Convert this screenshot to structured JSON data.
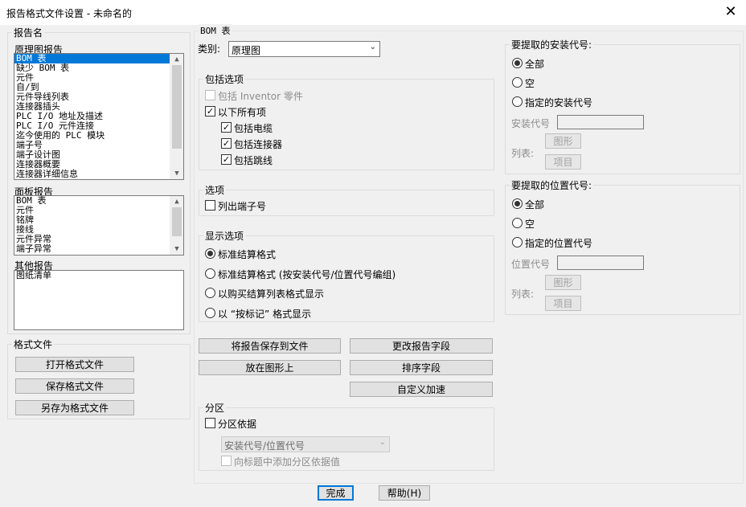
{
  "window": {
    "title": "报告格式文件设置 - 未命名的",
    "close": "✕"
  },
  "report_name": {
    "group_label": "报告名",
    "schematic_label": "原理图报告",
    "schematic_items": [
      "BOM 表",
      "缺少 BOM 表",
      "元件",
      "自/到",
      "元件导线列表",
      "连接器插头",
      "PLC I/O 地址及描述",
      "PLC I/O 元件连接",
      "迄今使用的 PLC 模块",
      "端子号",
      "端子设计图",
      "连接器概要",
      "连接器详细信息"
    ],
    "schematic_selected_index": 0,
    "panel_label": "面板报告",
    "panel_items": [
      "BOM 表",
      "元件",
      "铭牌",
      "接线",
      "元件异常",
      "端子异常"
    ],
    "other_label": "其他报告",
    "other_items": [
      "图纸清单"
    ]
  },
  "format_file": {
    "group_label": "格式文件",
    "open": "打开格式文件",
    "save": "保存格式文件",
    "save_as": "另存为格式文件"
  },
  "main": {
    "section_title": "BOM 表",
    "category_label": "类别:",
    "category_value": "原理图",
    "include_options": {
      "label": "包括选项",
      "inventor": "包括 Inventor 零件",
      "all_below": "以下所有项",
      "cables": "包括电缆",
      "connectors": "包括连接器",
      "jumpers": "包括跳线"
    },
    "options": {
      "label": "选项",
      "list_terminals": "列出端子号"
    },
    "display_options": {
      "label": "显示选项",
      "items": [
        "标准结算格式",
        "标准结算格式 (按安装代号/位置代号编组)",
        "以购买结算列表格式显示",
        "以 “按标记” 格式显示"
      ],
      "selected_index": 0
    },
    "buttons": {
      "save_to_file": "将报告保存到文件",
      "change_fields": "更改报告字段",
      "place_on_drawing": "放在图形上",
      "sort_fields": "排序字段",
      "user_post": "自定义加速"
    },
    "partition": {
      "label": "分区",
      "by": "分区依据",
      "select_value": "安装代号/位置代号",
      "add_to_title": "向标题中添加分区依据值"
    }
  },
  "installation": {
    "label": "要提取的安装代号:",
    "options": [
      "全部",
      "空",
      "指定的安装代号"
    ],
    "selected_index": 0,
    "code_label": "安装代号",
    "list_label": "列表:",
    "drawing_btn": "图形",
    "project_btn": "项目"
  },
  "location": {
    "label": "要提取的位置代号:",
    "options": [
      "全部",
      "空",
      "指定的位置代号"
    ],
    "selected_index": 0,
    "code_label": "位置代号",
    "list_label": "列表:",
    "drawing_btn": "图形",
    "project_btn": "项目"
  },
  "footer": {
    "done": "完成",
    "help": "帮助(H)"
  }
}
